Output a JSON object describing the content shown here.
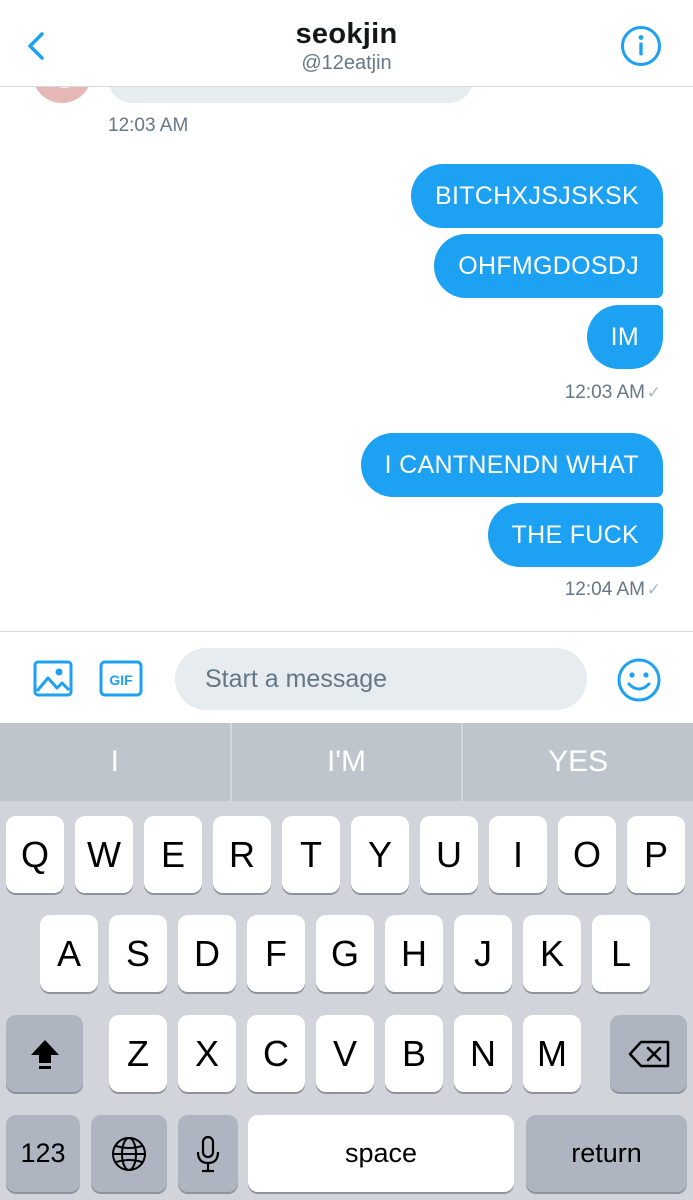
{
  "header": {
    "name": "seokjin",
    "handle": "@12eatjin",
    "back_icon": "chevron-left-icon",
    "info_icon": "info-icon"
  },
  "conversation": {
    "received_time": "12:03 AM",
    "groups": [
      {
        "messages": [
          "BITCHXJSJSKSK",
          "OHFMGDOSDJ",
          "IM"
        ],
        "time": "12:03 AM",
        "check": "✓"
      },
      {
        "messages": [
          "I CANTNENDN WHAT",
          "THE FUCK"
        ],
        "time": "12:04 AM",
        "check": "✓"
      }
    ]
  },
  "composer": {
    "placeholder": "Start a message",
    "gif_label": "GIF",
    "image_icon": "image-icon",
    "emoji_icon": "emoji-icon"
  },
  "keyboard": {
    "suggestions": [
      "I",
      "I'M",
      "YES"
    ],
    "row1": [
      "Q",
      "W",
      "E",
      "R",
      "T",
      "Y",
      "U",
      "I",
      "O",
      "P"
    ],
    "row2": [
      "A",
      "S",
      "D",
      "F",
      "G",
      "H",
      "J",
      "K",
      "L"
    ],
    "row3": [
      "Z",
      "X",
      "C",
      "V",
      "B",
      "N",
      "M"
    ],
    "numbers_label": "123",
    "space_label": "space",
    "return_label": "return"
  },
  "colors": {
    "accent": "#1da1f2",
    "bubble_text": "#ffffff",
    "secondary_text": "#657786",
    "keyboard_bg": "#d1d5db"
  }
}
